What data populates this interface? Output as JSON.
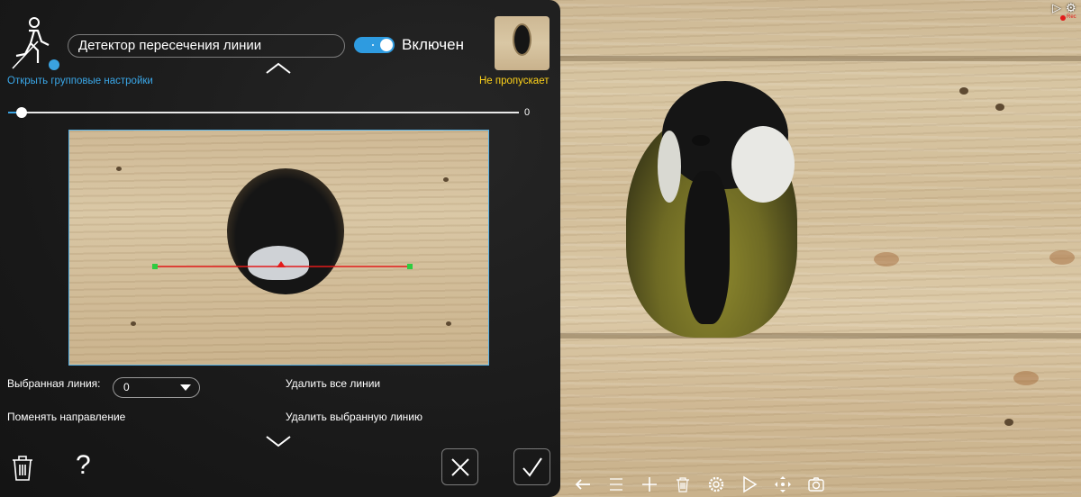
{
  "panel": {
    "detector_name": "Детектор пересечения линии",
    "toggle_label": "Включен",
    "toggle_on": true,
    "group_settings_link": "Открыть групповые настройки",
    "thumbnail_caption": "Не пропускает",
    "slider_value": "0",
    "selected_line_label": "Выбранная линия:",
    "selected_line_value": "0",
    "delete_all_lines": "Удалить все линии",
    "change_direction": "Поменять направление",
    "delete_selected_line": "Удалить выбранную линию",
    "help_symbol": "?"
  },
  "colors": {
    "accent": "#2e9be0",
    "caption_yellow": "#ffd31a",
    "line_red": "#e21b1b",
    "endpoint_green": "#2ecc40"
  },
  "camera": {
    "rec_label": "Rec",
    "toolbar_icons": [
      "arrow-left-icon",
      "menu-icon",
      "plus-icon",
      "trash-icon",
      "gear-icon",
      "play-icon",
      "move-icon",
      "camera-icon"
    ]
  }
}
